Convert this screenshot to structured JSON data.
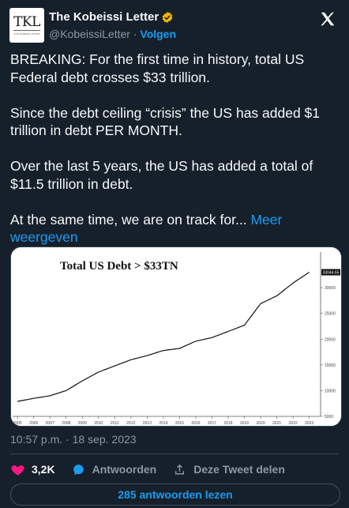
{
  "author": {
    "display_name": "The Kobeissi Letter",
    "handle": "@KobeissiLetter",
    "separator": " · ",
    "follow_label": "Volgen",
    "avatar_text": "TKL",
    "avatar_subtext": "THE KOBEISSI LETTER",
    "verified_color": "#f4b400"
  },
  "tweet": {
    "paragraphs": [
      "BREAKING: For the first time in history, total US Federal debt crosses $33 trillion.",
      "Since the debt ceiling “crisis” the US has added $1 trillion in debt PER MONTH.",
      "Over the last 5 years, the US has added a total of $11.5 trillion in debt."
    ],
    "last_paragraph": "At the same time, we are on track for... ",
    "more_label": "Meer weergeven"
  },
  "chart_data": {
    "type": "line",
    "title": "Total US Debt > $33TN",
    "x": [
      "2005",
      "2006",
      "2007",
      "2008",
      "2009",
      "2010",
      "2011",
      "2012",
      "2013",
      "2014",
      "2015",
      "2016",
      "2017",
      "2018",
      "2019",
      "2020",
      "2021",
      "2022",
      "2023"
    ],
    "series": [
      {
        "values": [
          7.9,
          8.5,
          9.0,
          10.0,
          11.9,
          13.6,
          14.8,
          16.0,
          16.8,
          17.8,
          18.2,
          19.6,
          20.3,
          21.5,
          22.7,
          26.9,
          28.4,
          30.9,
          33.0
        ]
      }
    ],
    "ylabel_ticks": [
      "5000",
      "10000",
      "15000",
      "20000",
      "25000",
      "30000"
    ],
    "last_value_label": "33044.65",
    "ylim": [
      5,
      36
    ],
    "line_color": "#111111",
    "grid": false
  },
  "meta": {
    "timestamp": "10:57 p.m. · 18 sep. 2023"
  },
  "actions": {
    "likes": "3,2K",
    "reply_label": "Antwoorden",
    "share_label": "Deze Tweet delen"
  },
  "read_replies_label": "285 antwoorden lezen",
  "colors": {
    "background": "#15202b",
    "accent": "#1d9bf0",
    "like": "#f91880",
    "muted": "#8b98a5"
  }
}
